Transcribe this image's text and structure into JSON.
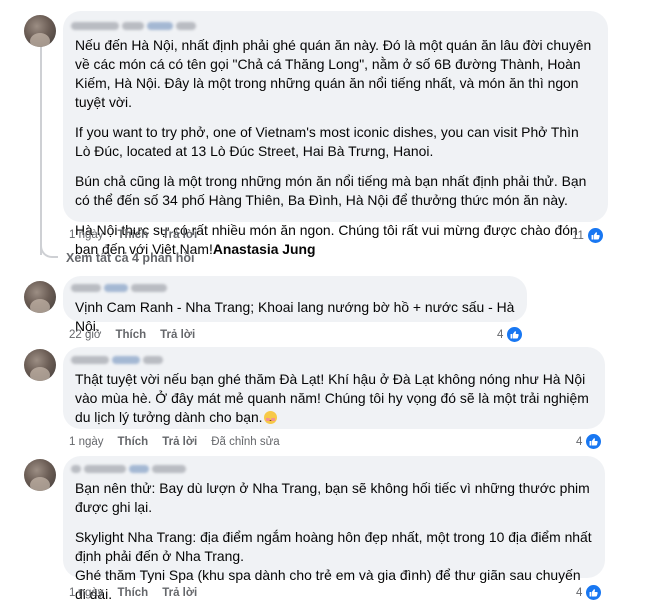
{
  "view_replies_label": "Xem tất cả 4 phản hồi",
  "like_label": "Thích",
  "reply_label": "Trả lời",
  "edited_label": "Đã chỉnh sửa",
  "accent_color": "#1877f2",
  "icons": {
    "like": "like-thumb-icon",
    "emoji": "smiling-face-emoji-icon"
  },
  "comments": [
    {
      "paragraphs": [
        "Nếu đến Hà Nội, nhất định phải ghé quán ăn này. Đó là một quán ăn lâu đời chuyên về các món cá có tên gọi \"Chả cá Thăng Long\", nằm ở số 6B đường Thành, Hoàn Kiếm, Hà Nội. Đây là một trong những quán ăn nổi tiếng nhất, và món ăn thì ngon tuyệt vời.",
        "If you want to try phở, one of Vietnam's most iconic dishes, you can visit Phở Thìn Lò Đúc, located at 13 Lò Đúc Street, Hai Bà Trưng, Hanoi.",
        "Bún chả cũng là một trong những món ăn nổi tiếng mà bạn nhất định phải thử. Bạn có thể đến số 34 phố Hàng Thiên, Ba Đình, Hà Nội để thưởng thức món ăn này.",
        "Hà Nội thực sự có rất nhiều món ăn ngon. Chúng tôi rất vui mừng được chào đón bạn đến với Việt Nam!"
      ],
      "mention": "Anastasia Jung",
      "time": "1 ngày",
      "reactions": "11"
    },
    {
      "paragraphs": [
        "Vịnh Cam Ranh - Nha Trang; Khoai lang nướng bờ hồ + nước sấu - Hà Nội."
      ],
      "time": "22 giờ",
      "reactions": "4"
    },
    {
      "paragraphs": [
        "Thật tuyệt vời nếu bạn ghé thăm Đà Lạt! Khí hậu ở Đà Lạt không nóng như Hà Nội vào mùa hè. Ở đây mát mẻ quanh năm! Chúng tôi hy vọng đó sẽ là một trải nghiệm du lịch lý tưởng dành cho bạn."
      ],
      "time": "1 ngày",
      "reactions": "4"
    },
    {
      "paragraphs": [
        "Bạn nên thử: Bay dù lượn ở Nha Trang, bạn sẽ không hối tiếc vì những thước phim được ghi lại.",
        "Skylight Nha Trang: địa điểm ngắm hoàng hôn đẹp nhất, một trong 10 địa điểm nhất định phải đến ở Nha Trang.",
        "Ghé thăm Tyni Spa (khu spa dành cho trẻ em và gia đình) để thư giãn sau chuyến đi dài."
      ],
      "time": "1 ngày",
      "reactions": "4"
    }
  ]
}
